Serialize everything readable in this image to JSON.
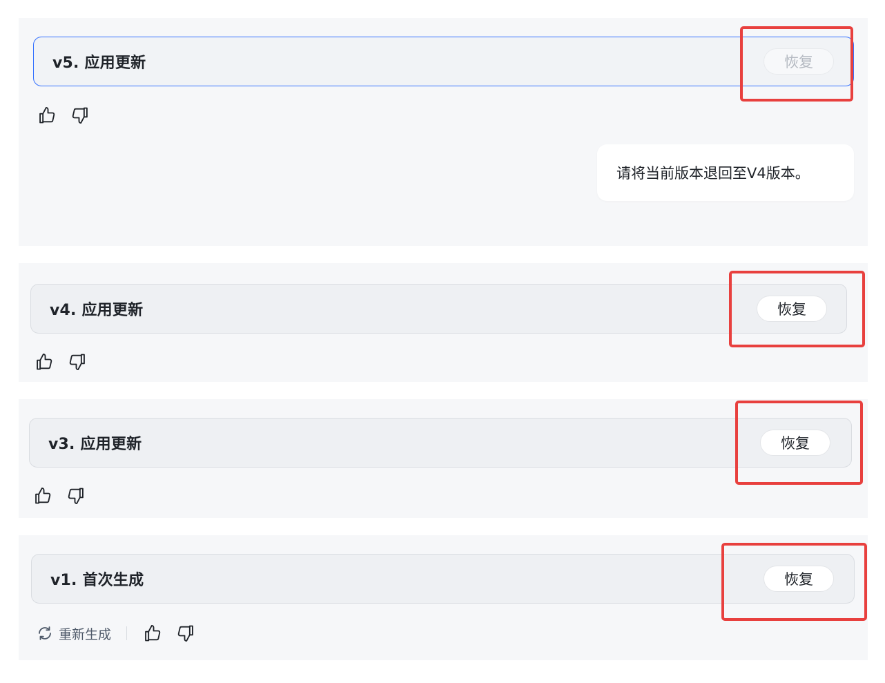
{
  "versions": [
    {
      "id": "v5",
      "label": "v5. 应用更新",
      "restore_label": "恢复",
      "restore_enabled": false,
      "active": true
    },
    {
      "id": "v4",
      "label": "v4. 应用更新",
      "restore_label": "恢复",
      "restore_enabled": true,
      "active": false
    },
    {
      "id": "v3",
      "label": "v3. 应用更新",
      "restore_label": "恢复",
      "restore_enabled": true,
      "active": false
    },
    {
      "id": "v1",
      "label": "v1. 首次生成",
      "restore_label": "恢复",
      "restore_enabled": true,
      "active": false
    }
  ],
  "user_message": {
    "text": "请将当前版本退回至V4版本。"
  },
  "regenerate": {
    "label": "重新生成"
  },
  "icons": {
    "like": "thumbs-up-icon",
    "dislike": "thumbs-down-icon",
    "regenerate": "refresh-icon"
  },
  "colors": {
    "active_border": "#3370ff",
    "highlight": "#e8403e",
    "panel_bg": "#f6f7f9",
    "bar_bg": "#eef0f3"
  }
}
